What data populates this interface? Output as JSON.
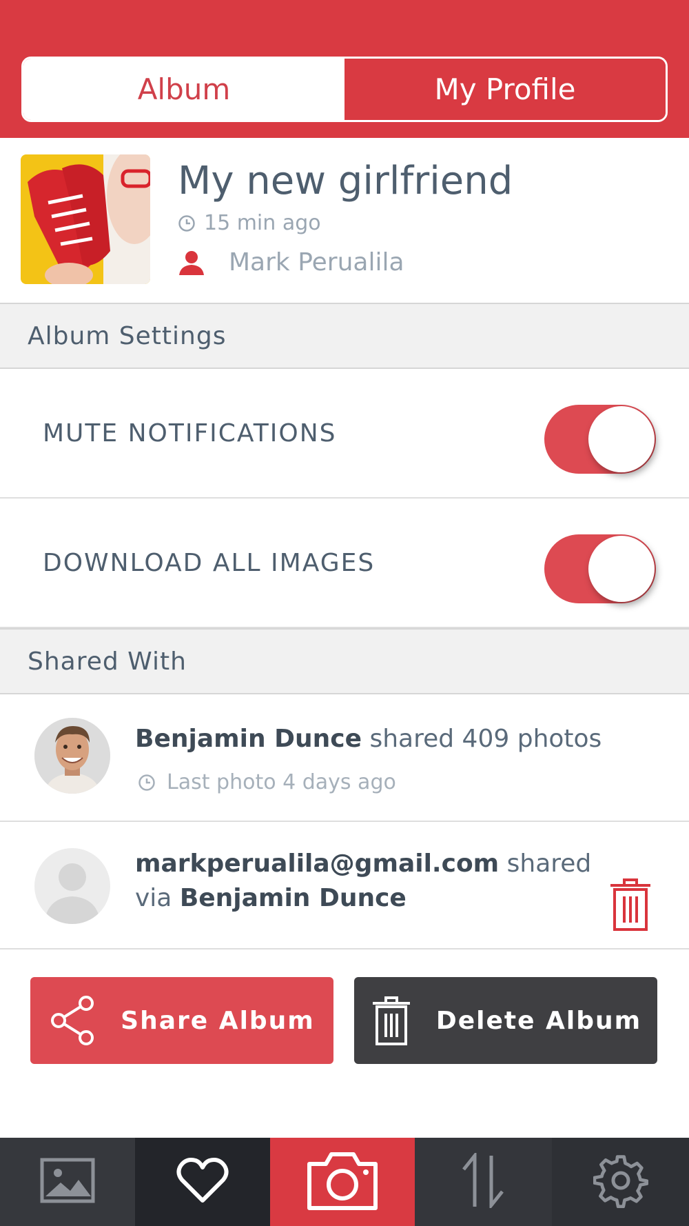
{
  "tabs": {
    "album": "Album",
    "profile": "My Profile"
  },
  "album": {
    "title": "My new girlfriend",
    "time": "15 min ago",
    "owner": "Mark Perualila"
  },
  "sections": {
    "settings": "Album Settings",
    "shared": "Shared With"
  },
  "settings": [
    {
      "label": "MUTE NOTIFICATIONS",
      "enabled": true
    },
    {
      "label": "DOWNLOAD ALL IMAGES",
      "enabled": true
    }
  ],
  "shared": [
    {
      "name": "Benjamin Dunce",
      "action": " shared 409 photos",
      "sub": "Last photo 4 days ago"
    },
    {
      "email": "markperualila@gmail.com",
      "action": " shared",
      "via": "via ",
      "via_name": "Benjamin Dunce"
    }
  ],
  "buttons": {
    "share": "Share Album",
    "delete": "Delete Album"
  },
  "nav": [
    "gallery-icon",
    "heart-icon",
    "camera-icon",
    "sort-icon",
    "gear-icon"
  ],
  "colors": {
    "accent": "#d93a42",
    "dark_button": "#3f3f42",
    "nav_bg": "#2a2c30"
  }
}
